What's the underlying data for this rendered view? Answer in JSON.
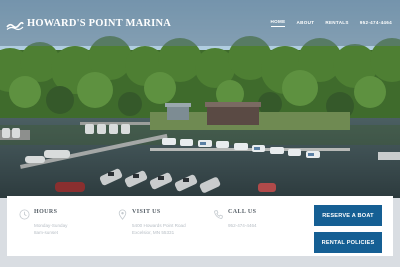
{
  "header": {
    "brand_name": "HOWARD'S POINT MARINA",
    "brand_icon": "wave-logo-icon",
    "nav": [
      {
        "label": "HOME",
        "active": true
      },
      {
        "label": "ABOUT",
        "active": false
      },
      {
        "label": "RENTALS",
        "active": false
      },
      {
        "label": "952-474-4464",
        "active": false
      }
    ]
  },
  "hero": {
    "image": "aerial-marina-photo"
  },
  "info": {
    "hours": {
      "title": "HOURS",
      "icon": "clock-icon",
      "lines": [
        "Monday-Sunday",
        "8am-sunset"
      ]
    },
    "visit": {
      "title": "VISIT US",
      "icon": "map-pin-icon",
      "lines": [
        "5400 Howards Point Road",
        "Excelsior, MN 55331"
      ]
    },
    "call": {
      "title": "CALL US",
      "icon": "phone-icon",
      "lines": [
        "952-474-4464"
      ]
    }
  },
  "actions": {
    "reserve_label": "RESERVE A BOAT",
    "policies_label": "RENTAL POLICIES"
  },
  "colors": {
    "accent": "#155f94",
    "header_overlay": "#5f788c",
    "info_title": "#555e66",
    "info_text": "#b7bec5"
  }
}
